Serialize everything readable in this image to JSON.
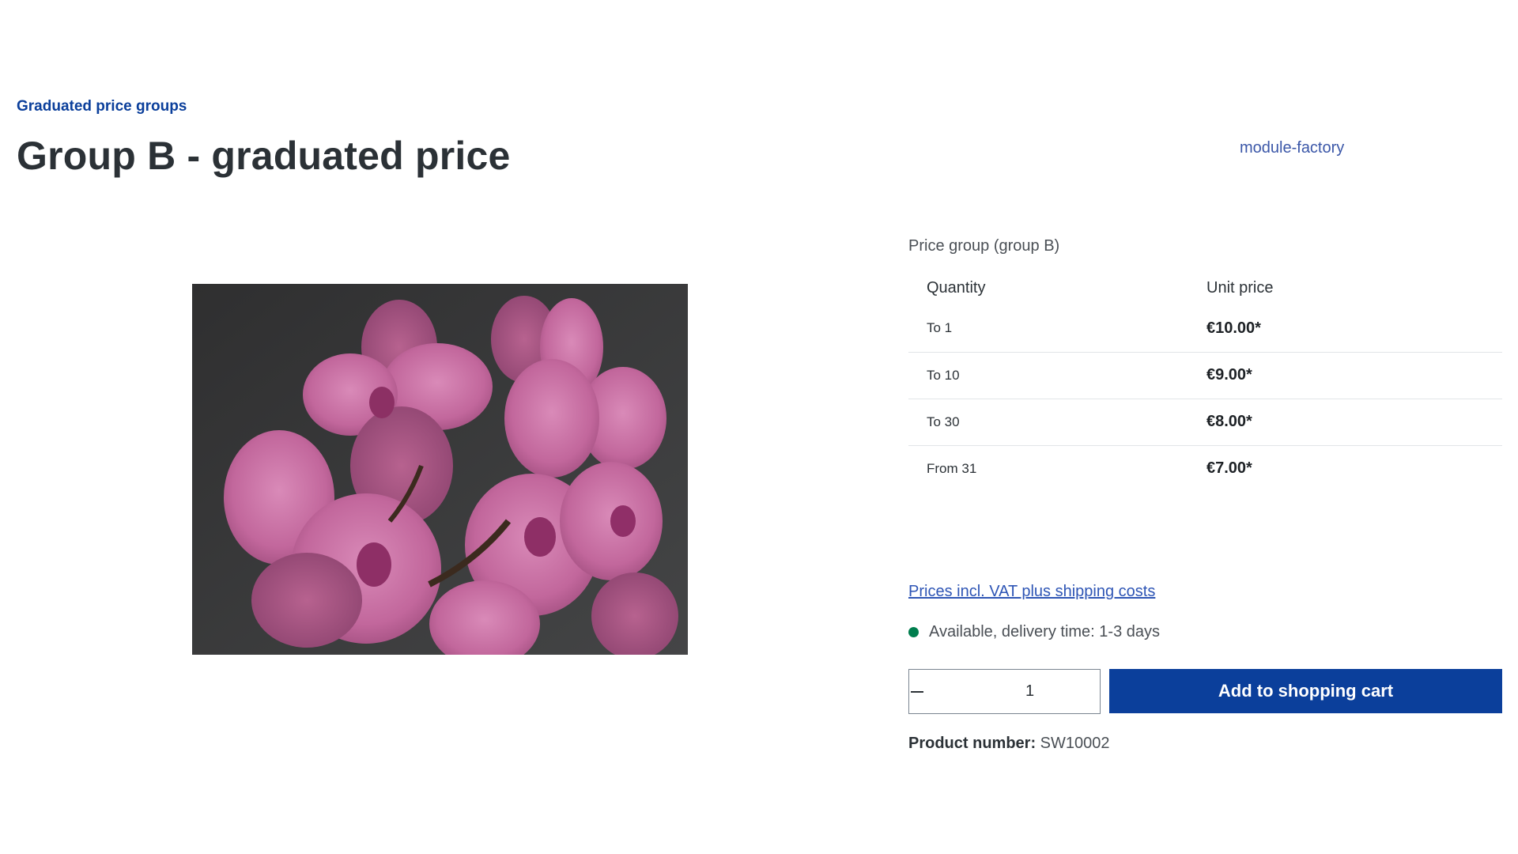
{
  "breadcrumb": {
    "category": "Graduated price groups"
  },
  "product": {
    "title": "Group B - graduated price",
    "manufacturer": "module-factory",
    "image_alt": "pink orchid",
    "price_group": "Price group (group B)",
    "price_table": {
      "headers": [
        "Quantity",
        "Unit price"
      ],
      "rows": [
        {
          "quantity": "To 1",
          "price": "€10.00*"
        },
        {
          "quantity": "To 10",
          "price": "€9.00*"
        },
        {
          "quantity": "To 30",
          "price": "€8.00*"
        },
        {
          "quantity": "From 31",
          "price": "€7.00*"
        }
      ]
    },
    "vat_note": "Prices incl. VAT plus shipping costs",
    "availability": "Available, delivery time: 1-3 days",
    "availability_color": "#007e4e",
    "quantity": "1",
    "add_to_cart_label": "Add to shopping cart",
    "product_number_label": "Product number:",
    "product_number": "SW10002"
  },
  "colors": {
    "accent": "#0b3f9b",
    "link": "#2e55b5"
  },
  "icons": {
    "decrease": "minus-icon",
    "increase": "plus-icon"
  }
}
